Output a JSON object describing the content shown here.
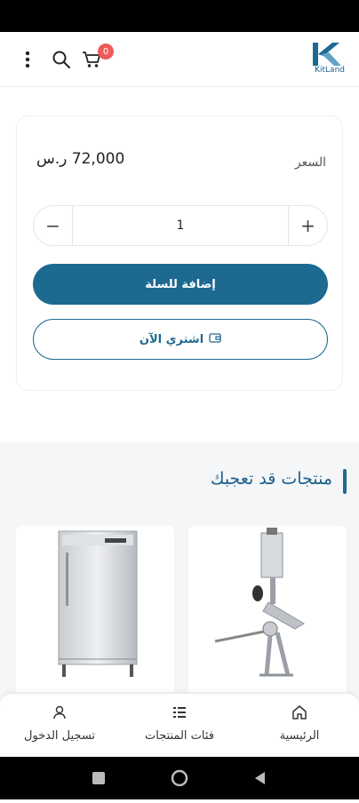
{
  "header": {
    "logo_text": "KitLand",
    "cart_count": "0",
    "icons": [
      "more-vert-icon",
      "search-icon",
      "cart-icon",
      "kitland-logo"
    ]
  },
  "product_card": {
    "price_label": "السعر",
    "price_value": "72,000 ر.س",
    "quantity": "1",
    "minus_symbol": "−",
    "plus_symbol": "+",
    "add_to_cart_label": "إضافة للسلة",
    "buy_now_label": "اشتري الآن"
  },
  "recommended": {
    "title": "منتجات قد تعجبك"
  },
  "bottom_nav": {
    "items": [
      {
        "label": "الرئيسية",
        "icon": "home-icon"
      },
      {
        "label": "فئات المنتجات",
        "icon": "list-icon"
      },
      {
        "label": "تسجيل الدخول",
        "icon": "user-icon"
      }
    ]
  },
  "colors": {
    "primary": "#1d6a91",
    "badge": "#ef5b5b",
    "section_bg": "#f4f6f8"
  }
}
